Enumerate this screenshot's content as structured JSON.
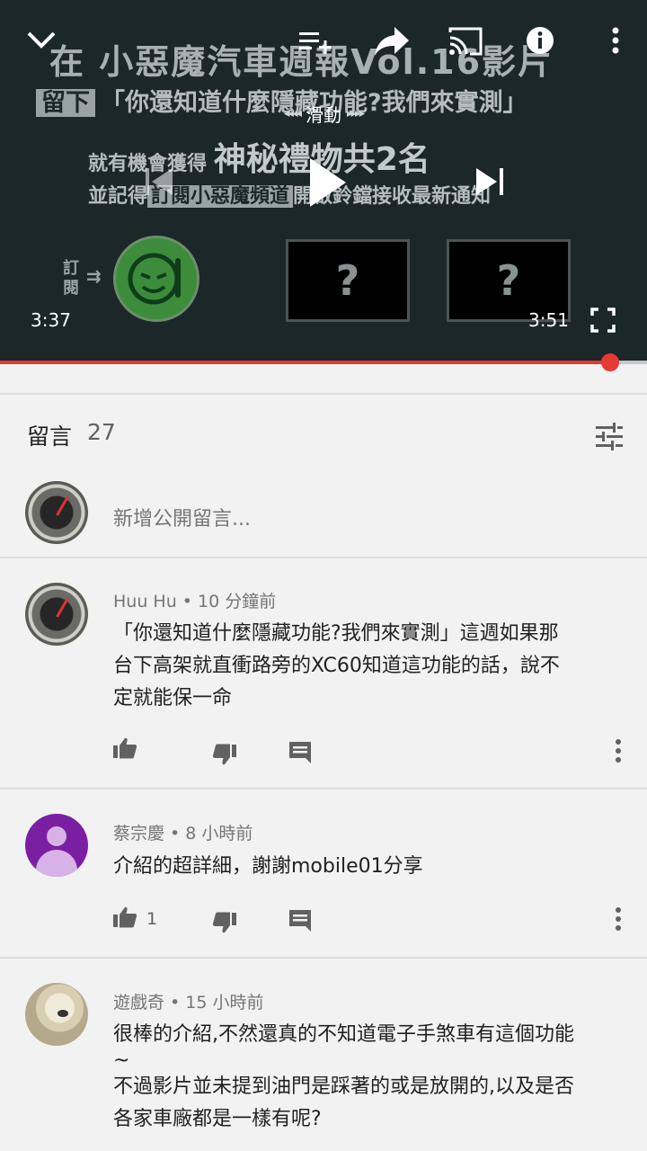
{
  "video": {
    "line1": "在 小惡魔汽車週報Vol.16影片",
    "line2_tag": "留下",
    "line2": "「你還知道什麼隱藏功能?我們來實測」",
    "line3_pre": "就有機會獲得",
    "line3_big": "神秘禮物共2名",
    "line4_pre": "並記得",
    "line4_tag": "訂閱小惡魔頻道",
    "line4_post": "開啟鈴鐺接收最新通知",
    "subscribe_label": "訂閱",
    "question_mark": "?",
    "swipe_hint": "滑動",
    "current_time": "3:37",
    "duration": "3:51",
    "progress_fraction": 0.9437
  },
  "comments_section": {
    "title": "留言",
    "count": "27",
    "add_placeholder": "新增公開留言..."
  },
  "comments": [
    {
      "author_meta": "Huu Hu • 10 分鐘前",
      "lines": [
        "「你還知道什麼隱藏功能?我們來實測」這週如果那",
        "台下高架就直衝路旁的XC60知道這功能的話，說不",
        "定就能保一命"
      ],
      "likes": ""
    },
    {
      "author_meta": "蔡宗慶 • 8 小時前",
      "lines": [
        "介紹的超詳細，謝謝mobile01分享"
      ],
      "likes": "1"
    },
    {
      "author_meta": "遊戲奇 • 15 小時前",
      "lines": [
        "很棒的介紹,不然還真的不知道電子手煞車有這個功能",
        "~",
        "不過影片並未提到油門是踩著的或是放開的,以及是否",
        "各家車廠都是一樣有呢?"
      ],
      "likes": ""
    }
  ],
  "colors": {
    "accent": "#e53935",
    "background": "#f2f2f2",
    "purple_avatar": "#7b1fa2"
  }
}
